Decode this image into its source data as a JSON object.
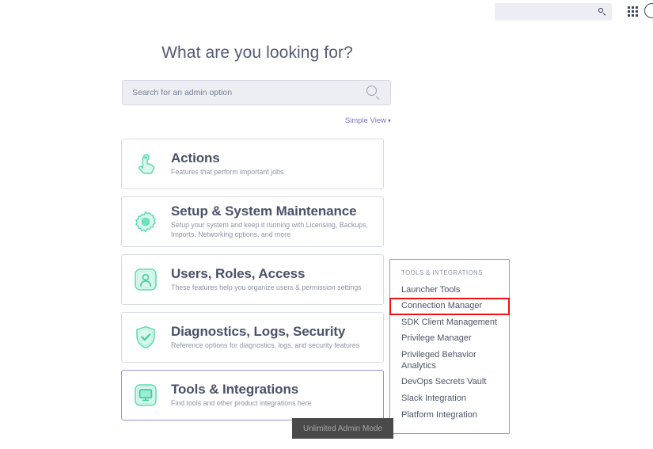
{
  "topbar": {
    "search_placeholder": "",
    "search_value": "",
    "search_icon": "search-icon",
    "apps_icon": "apps-grid-icon",
    "avatar_icon": "user-avatar-icon"
  },
  "page": {
    "title": "What are you looking for?"
  },
  "search": {
    "placeholder": "Search for an admin option",
    "value": "",
    "icon": "search-icon"
  },
  "view_toggle": {
    "label": "Simple View",
    "chevron": "⌄",
    "icon": "chevron-down-icon",
    "color": "#7a72c7"
  },
  "cards": [
    {
      "title": "Actions",
      "subtitle": "Features that perform important jobs",
      "icon": "hand-click-icon",
      "selected": false
    },
    {
      "title": "Setup & System Maintenance",
      "subtitle": "Setup your system and keep it running with Licensing, Backups, Imports, Networking options, and more",
      "icon": "gear-icon",
      "selected": false
    },
    {
      "title": "Users, Roles, Access",
      "subtitle": "These features help you organize users & permission settings",
      "icon": "user-icon",
      "selected": false
    },
    {
      "title": "Diagnostics, Logs, Security",
      "subtitle": "Reference options for diagnostics, logs, and security features",
      "icon": "shield-check-icon",
      "selected": false
    },
    {
      "title": "Tools & Integrations",
      "subtitle": "Find tools and other product integrations here",
      "icon": "monitor-icon",
      "selected": true
    }
  ],
  "flyout": {
    "header": "TOOLS & INTEGRATIONS",
    "items": [
      {
        "label": "Launcher Tools",
        "highlighted": false
      },
      {
        "label": "Connection Manager",
        "highlighted": true
      },
      {
        "label": "SDK Client Management",
        "highlighted": false
      },
      {
        "label": "Privilege Manager",
        "highlighted": false
      },
      {
        "label": "Privileged Behavior Analytics",
        "highlighted": false
      },
      {
        "label": "DevOps Secrets Vault",
        "highlighted": false
      },
      {
        "label": "Slack Integration",
        "highlighted": false
      },
      {
        "label": "Platform Integration",
        "highlighted": false
      }
    ],
    "highlight_color": "#ee1111",
    "border_color": "#9b93d4"
  },
  "status_banner": {
    "text": "Unlimited Admin Mode",
    "background": "#4a4a4a",
    "color": "#a6a6a6"
  },
  "theme": {
    "accent_mint": "#6fe0bd",
    "accent_purple": "#9b93d4",
    "text_dark": "#4a5168",
    "text_muted": "#8d93a5"
  }
}
